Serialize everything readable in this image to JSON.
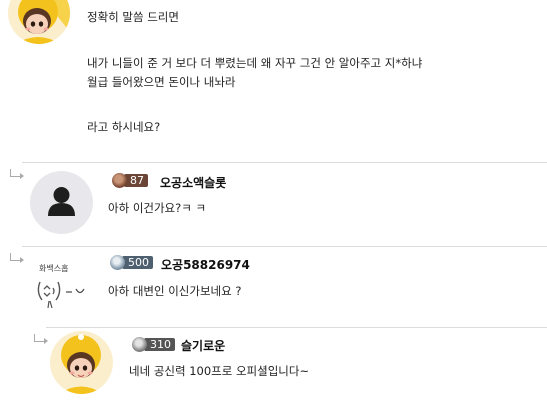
{
  "first_comment": {
    "lines": [
      "정확히 말씀 드리면",
      "",
      "내가 니들이 준 거 보다 더 뿌렸는데 왜 자꾸 그건 안 알아주고 지*하냐",
      "월급 들어왔으면 돈이나 내놔라",
      "",
      "라고 하시네요?"
    ]
  },
  "replies": [
    {
      "level": "87",
      "nickname": "오공소액슬롯",
      "text": "아하 이건가요?ㅋ ㅋ",
      "avatar_icon": "default-person-icon"
    },
    {
      "level": "500",
      "nickname": "오공58826974",
      "text": "아하 대변인 이신가보네요 ?",
      "avatar_icon": "doodle-face-avatar",
      "avatar_caption": "화백스홉"
    },
    {
      "level": "310",
      "nickname": "슬기로운",
      "text": "네네 공신력 100프로 오피셜입니다~",
      "avatar_icon": "yellow-hat-girl-avatar"
    }
  ],
  "colors": {
    "divider": "#dcdcdc",
    "hat_yellow": "#f4c21c",
    "default_avatar_bg": "#e8e8ec"
  }
}
